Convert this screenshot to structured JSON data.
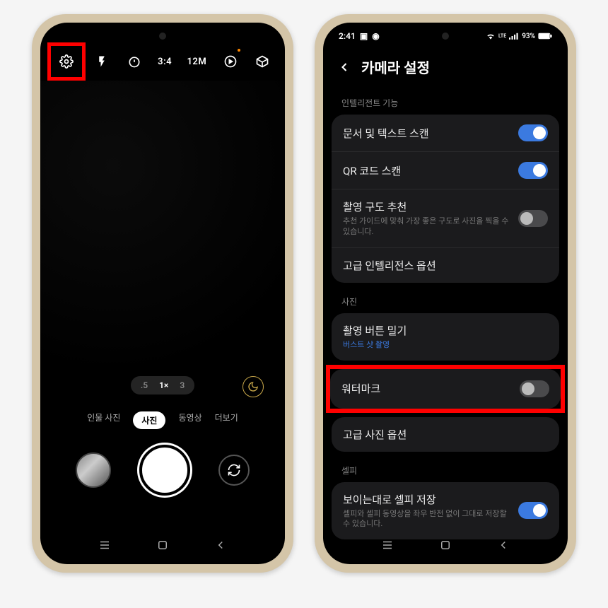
{
  "left": {
    "topbar": {
      "ratio": "3:4",
      "resolution": "12M"
    },
    "zoom": {
      "wide": ".5",
      "normal": "1×",
      "tele": "3"
    },
    "modes": {
      "portrait": "인물 사진",
      "photo": "사진",
      "video": "동영상",
      "more": "더보기"
    }
  },
  "right": {
    "status": {
      "time": "2:41",
      "battery": "93%"
    },
    "header": "카메라 설정",
    "section_intelligent": "인텔리전트 기능",
    "scan_doc": "문서 및 텍스트 스캔",
    "scan_qr": "QR 코드 스캔",
    "composition_title": "촬영 구도 추천",
    "composition_sub": "추천 가이드에 맞춰 가장 좋은 구도로 사진을 찍을 수 있습니다.",
    "adv_intel": "고급 인텔리전스 옵션",
    "section_photo": "사진",
    "shutter_drag_title": "촬영 버튼 밀기",
    "shutter_drag_sub": "버스트 샷 촬영",
    "watermark": "워터마크",
    "adv_photo": "고급 사진 옵션",
    "section_selfie": "셀피",
    "selfie_title": "보이는대로 셀피 저장",
    "selfie_sub": "셀피와 셀피 동영상을 좌우 반전 없이 그대로 저장할 수 있습니다."
  }
}
